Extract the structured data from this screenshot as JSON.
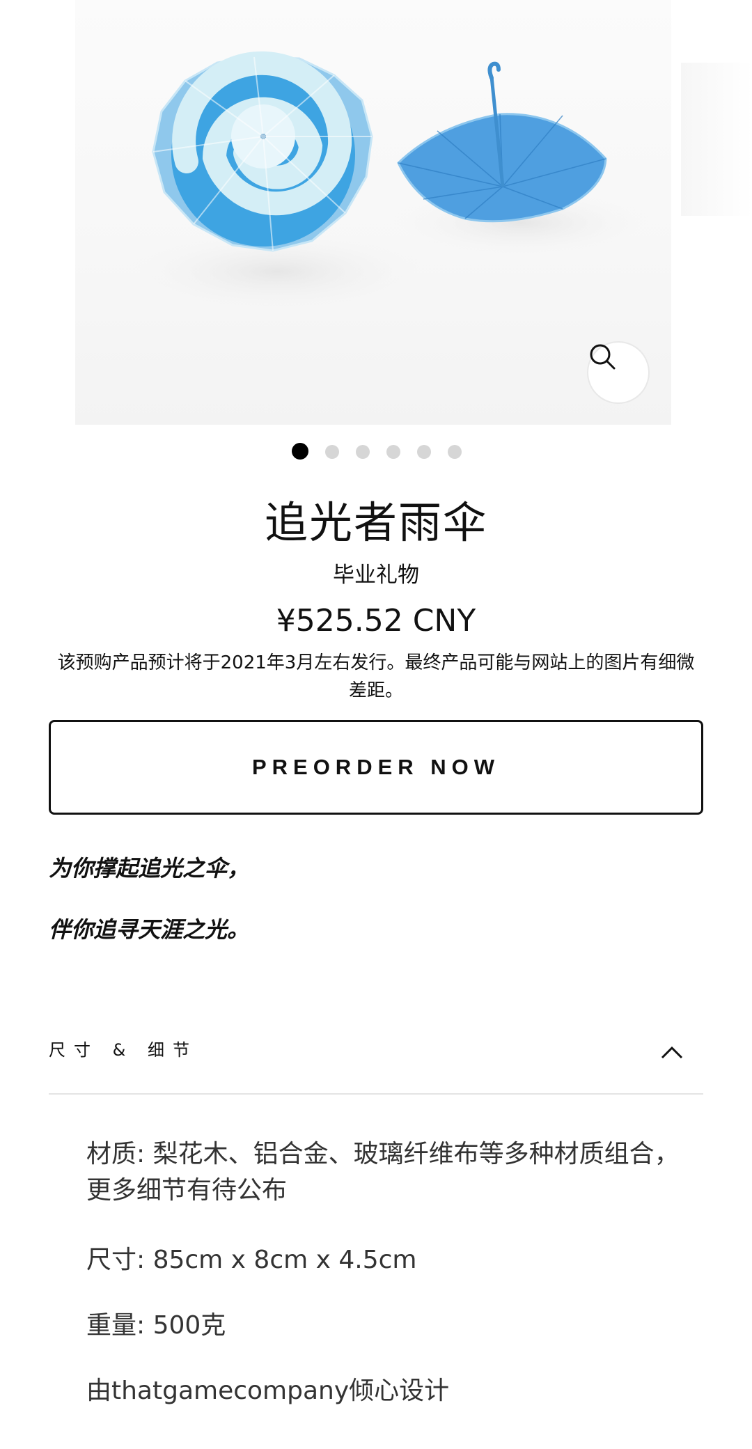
{
  "gallery": {
    "image_alt": "追光者雨伞",
    "zoom_icon": "magnifier-icon",
    "dot_count": 6,
    "active_dot": 1
  },
  "product": {
    "title": "追光者雨伞",
    "subtitle": "毕业礼物",
    "price": "¥525.52 CNY",
    "notice": "该预购产品预计将于2021年3月左右发行。最终产品可能与网站上的图片有细微差距。"
  },
  "actions": {
    "preorder_label": "PREORDER NOW"
  },
  "description": {
    "line1": "为你撑起追光之伞，",
    "line2": "伴你追寻天涯之光。"
  },
  "accordion": {
    "label": "尺寸 & 细节",
    "chevron_icon": "chevron-up-icon",
    "details": [
      "材质: 梨花木、铝合金、玻璃纤维布等多种材质组合，更多细节有待公布",
      "尺寸: 85cm x 8cm x 4.5cm",
      "重量: 500克",
      "由thatgamecompany倾心设计"
    ]
  },
  "colors": {
    "umbrella_blue": "#4aa3e0",
    "umbrella_light": "#cfeaf4",
    "active_dot": "#000000",
    "inactive_dot": "#d6d6d6",
    "divider": "#e4e4e4"
  }
}
